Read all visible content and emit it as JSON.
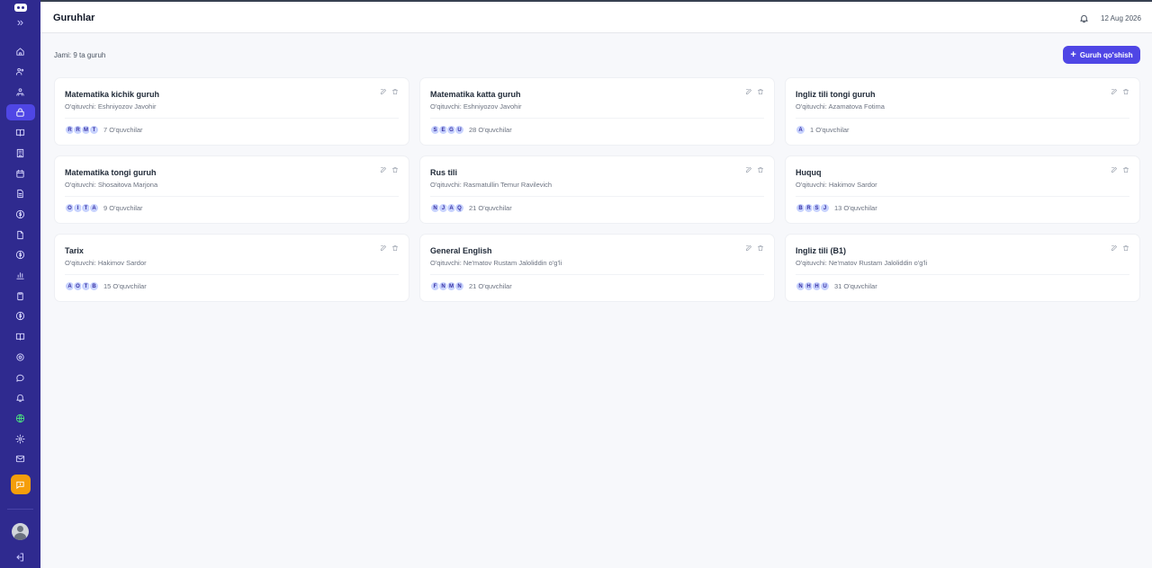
{
  "header": {
    "title": "Guruhlar",
    "date": "12 Aug 2026"
  },
  "toolbar": {
    "total": "Jami: 9 ta guruh",
    "add_label": "Guruh qo'shish"
  },
  "cards": [
    {
      "title": "Matematika kichik guruh",
      "teacher": "O'qituvchi: Eshniyozov Javohir",
      "avatars": [
        "R",
        "R",
        "M",
        "T"
      ],
      "count": "7 O'quvchilar"
    },
    {
      "title": "Matematika katta guruh",
      "teacher": "O'qituvchi: Eshniyozov Javohir",
      "avatars": [
        "S",
        "E",
        "G",
        "U"
      ],
      "count": "28 O'quvchilar"
    },
    {
      "title": "Ingliz tili tongi guruh",
      "teacher": "O'qituvchi: Azamatova Fotima",
      "avatars": [
        "A"
      ],
      "count": "1 O'quvchilar"
    },
    {
      "title": "Matematika tongi guruh",
      "teacher": "O'qituvchi: Shosaitova Marjona",
      "avatars": [
        "O",
        "I",
        "T",
        "A"
      ],
      "count": "9 O'quvchilar"
    },
    {
      "title": "Rus tili",
      "teacher": "O'qituvchi: Rasmatullin Temur Ravilevich",
      "avatars": [
        "N",
        "J",
        "A",
        "Q"
      ],
      "count": "21 O'quvchilar"
    },
    {
      "title": "Huquq",
      "teacher": "O'qituvchi: Hakimov Sardor",
      "avatars": [
        "B",
        "R",
        "S",
        "J"
      ],
      "count": "13 O'quvchilar"
    },
    {
      "title": "Tarix",
      "teacher": "O'qituvchi: Hakimov Sardor",
      "avatars": [
        "A",
        "O",
        "T",
        "B"
      ],
      "count": "15 O'quvchilar"
    },
    {
      "title": "General English",
      "teacher": "O'qituvchi: Ne'matov Rustam Jaloliddin o'g'li",
      "avatars": [
        "F",
        "N",
        "M",
        "N"
      ],
      "count": "21 O'quvchilar"
    },
    {
      "title": "Ingliz tili (B1)",
      "teacher": "O'qituvchi: Ne'matov Rustam Jaloliddin o'g'li",
      "avatars": [
        "N",
        "H",
        "H",
        "U"
      ],
      "count": "31 O'quvchilar"
    }
  ],
  "sidebar": {
    "items": [
      {
        "icon": "home-icon"
      },
      {
        "icon": "users-icon"
      },
      {
        "icon": "team-icon"
      },
      {
        "icon": "groups-icon",
        "active": true
      },
      {
        "icon": "book-icon"
      },
      {
        "icon": "building-icon"
      },
      {
        "icon": "calendar-icon"
      },
      {
        "icon": "document-icon"
      },
      {
        "icon": "dollar-icon"
      },
      {
        "icon": "file-icon"
      },
      {
        "icon": "dollar-icon"
      },
      {
        "icon": "chart-icon"
      },
      {
        "icon": "clipboard-icon"
      },
      {
        "icon": "dollar-icon"
      },
      {
        "icon": "book-open-icon"
      },
      {
        "icon": "settings-icon"
      },
      {
        "icon": "chat-icon"
      },
      {
        "icon": "bell-icon"
      },
      {
        "icon": "globe-icon"
      },
      {
        "icon": "gear-icon"
      },
      {
        "icon": "mail-icon"
      }
    ]
  }
}
